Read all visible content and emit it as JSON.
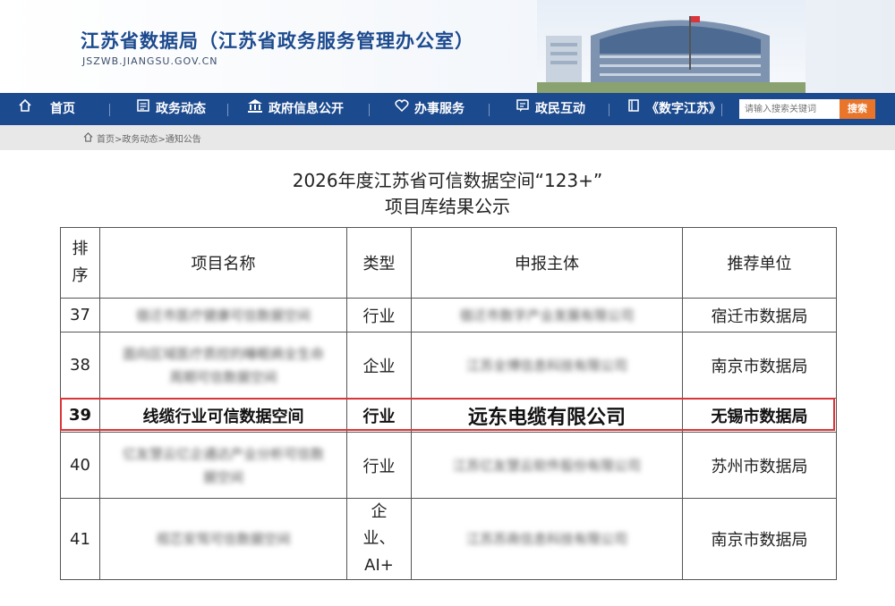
{
  "header": {
    "site_title": "江苏省数据局（江苏省政务服务管理办公室）",
    "site_domain": "JSZWB.JIANGSU.GOV.CN"
  },
  "nav": {
    "items": [
      {
        "label": "首页",
        "icon": "home-icon"
      },
      {
        "label": "政务动态",
        "icon": "news-icon"
      },
      {
        "label": "政府信息公开",
        "icon": "building-icon"
      },
      {
        "label": "办事服务",
        "icon": "service-icon"
      },
      {
        "label": "政民互动",
        "icon": "chat-icon"
      },
      {
        "label": "《数字江苏》",
        "icon": "book-icon"
      }
    ],
    "search_placeholder": "请输入搜索关键词",
    "search_button": "搜索"
  },
  "breadcrumb": "首页>政务动态>通知公告",
  "notice": {
    "title_line1": "2026年度江苏省可信数据空间“123+”",
    "title_line2": "项目库结果公示"
  },
  "table": {
    "headers": [
      "排序",
      "项目名称",
      "类型",
      "申报主体",
      "推荐单位"
    ],
    "rows": [
      {
        "rank": "37",
        "name": "宿迁市医疗健康可信数据空间",
        "type": "行业",
        "applicant": "宿迁市数字产业发展有限公司",
        "recommender": "宿迁市数据局",
        "blurred": true
      },
      {
        "rank": "38",
        "name": "面向区域医疗质控的睡眠病全生命周期可信数据空间",
        "type": "企业",
        "applicant": "江苏全博信息科技有限公司",
        "recommender": "南京市数据局",
        "blurred": true
      },
      {
        "rank": "39",
        "name": "线缆行业可信数据空间",
        "type": "行业",
        "applicant": "远东电缆有限公司",
        "recommender": "无锡市数据局",
        "blurred": false
      },
      {
        "rank": "40",
        "name": "亿友慧云亿企通达产业分析可信数据空间",
        "type": "行业",
        "applicant": "江苏亿友慧云软件股份有限公司",
        "recommender": "苏州市数据局",
        "blurred": true
      },
      {
        "rank": "41",
        "name": "视芯安驾可信数据空间",
        "type": "企业、AI+",
        "applicant": "江苏苏商信息科技有限公司",
        "recommender": "南京市数据局",
        "blurred": true
      }
    ]
  },
  "colors": {
    "brand_blue": "#1c4a8e",
    "search_orange": "#e8752a",
    "highlight_red": "#d9353a"
  }
}
